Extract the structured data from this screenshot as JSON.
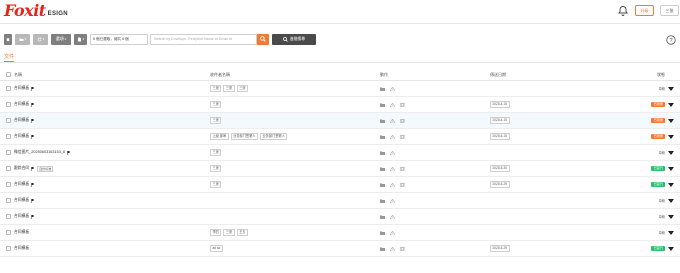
{
  "header": {
    "logo_main": "Foxit",
    "logo_sub": "ESIGN",
    "upgrade_label": "升级",
    "user_label": "三张"
  },
  "toolbar": {
    "filter_text": "6 個已選取，總共 6 個",
    "search_placeholder": "Search by Envelope, Recipient Name or Email Id",
    "advanced_search_label": "進階搜尋",
    "dropdown_label": "選項"
  },
  "tab": {
    "label": "文件"
  },
  "table": {
    "headers": {
      "name": "名稱",
      "recipients": "收件者名稱",
      "ops": "動作",
      "date": "傳送日期",
      "status": "狀態"
    },
    "rows": [
      {
        "name": "合同模板",
        "flag": true,
        "tag": "",
        "recipients": [
          "三张",
          "三张",
          "三张"
        ],
        "date": "",
        "status": "草稿",
        "badge": ""
      },
      {
        "name": "合同模板",
        "flag": true,
        "tag": "",
        "recipients": [
          "三张"
        ],
        "date": "2025-4-15",
        "status": "",
        "badge": "已拒絕"
      },
      {
        "name": "合同模板",
        "flag": true,
        "tag": "",
        "recipients": [
          "三张"
        ],
        "date": "2025-4-15",
        "status": "",
        "badge": "已拒絕"
      },
      {
        "name": "合同模板",
        "flag": true,
        "tag": "",
        "recipients": [
          "上級 部审",
          "业务部门签署人",
          "业务部门签署人"
        ],
        "date": "2025-5-15",
        "status": "",
        "badge": "已拒絕"
      },
      {
        "name": "微信图片_20250603163153_6",
        "flag": true,
        "tag": "",
        "recipients": [
          "三张"
        ],
        "date": "",
        "status": "草稿",
        "badge": ""
      },
      {
        "name": "跟踪合同",
        "flag": true,
        "tag": "四份标准",
        "recipients": [
          "三张"
        ],
        "date": "2025-5-30",
        "status": "",
        "badge": "已簽行"
      },
      {
        "name": "合同模板",
        "flag": true,
        "tag": "",
        "recipients": [
          "三张"
        ],
        "date": "2025-5-29",
        "status": "",
        "badge": "已簽行"
      },
      {
        "name": "合同模板",
        "flag": true,
        "tag": "",
        "recipients": [],
        "date": "",
        "status": "草稿",
        "badge": ""
      },
      {
        "name": "合同模板",
        "flag": true,
        "tag": "",
        "recipients": [],
        "date": "",
        "status": "草稿",
        "badge": ""
      },
      {
        "name": "合同模板",
        "flag": false,
        "tag": "",
        "recipients": [
          "李四",
          "三张",
          "王五"
        ],
        "date": "",
        "status": "草稿",
        "badge": ""
      },
      {
        "name": "合同模板",
        "flag": false,
        "tag": "",
        "recipients": [
          "ad sd"
        ],
        "date": "2025-5-29",
        "status": "",
        "badge": "已簽行"
      }
    ]
  },
  "colors": {
    "accent": "#f07a34",
    "brand_red": "#e8231d",
    "success": "#2fbf71",
    "toolbar_gray": "#7f7f7f"
  }
}
